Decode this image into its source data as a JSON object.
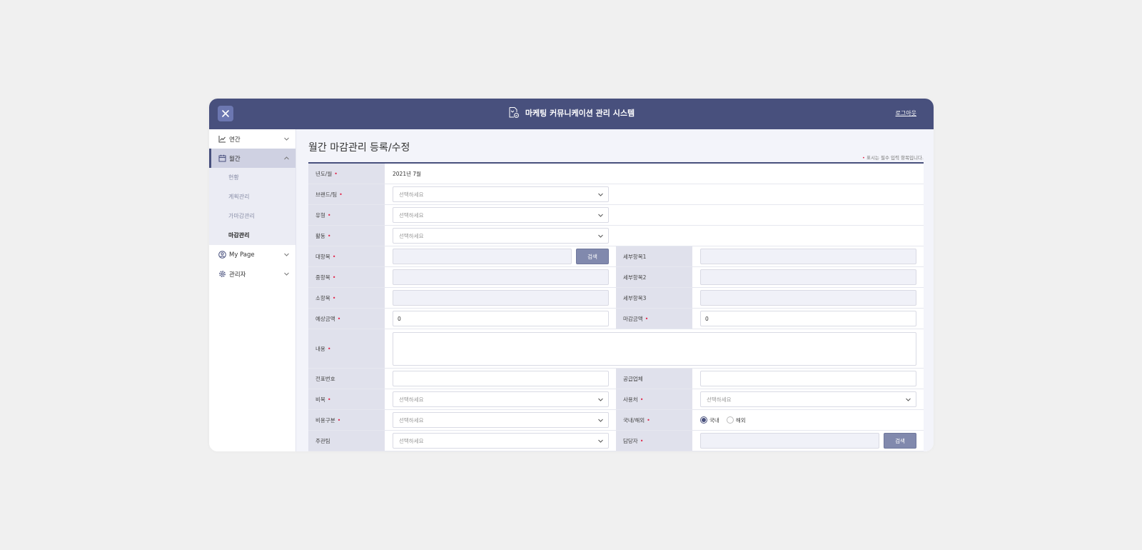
{
  "app": {
    "title": "마케팅 커뮤니케이션 관리 시스템",
    "logout_label": "로그아웃"
  },
  "sidebar": {
    "items": [
      {
        "label": "연간"
      },
      {
        "label": "월간"
      },
      {
        "label": "My Page"
      },
      {
        "label": "관리자"
      }
    ],
    "sub_items": [
      {
        "label": "현황"
      },
      {
        "label": "계획관리"
      },
      {
        "label": "가마감관리"
      },
      {
        "label": "마감관리"
      }
    ]
  },
  "page": {
    "title": "월간 마감관리 등록/수정",
    "required_note": "표시는 필수 입력 항목입니다.",
    "required_mark": "•"
  },
  "form": {
    "year_month": {
      "label": "년도/월",
      "value": "2021년 7월"
    },
    "brand_team": {
      "label": "브랜드/팀",
      "value": "선택하세요"
    },
    "type": {
      "label": "유형",
      "value": "선택하세요"
    },
    "activity": {
      "label": "활동",
      "value": "선택하세요"
    },
    "major_item": {
      "label": "대항목",
      "button": "검색"
    },
    "detail1": {
      "label": "세부항목1"
    },
    "middle_item": {
      "label": "중항목"
    },
    "detail2": {
      "label": "세부항목2"
    },
    "minor_item": {
      "label": "소항목"
    },
    "detail3": {
      "label": "세부항목3"
    },
    "expected_amount": {
      "label": "예상금액",
      "value": "0"
    },
    "closing_amount": {
      "label": "마감금액",
      "value": "0"
    },
    "content": {
      "label": "내용"
    },
    "slip_number": {
      "label": "전표번호"
    },
    "supplier": {
      "label": "공급업체"
    },
    "expense_item": {
      "label": "비목",
      "value": "선택하세요"
    },
    "usage_place": {
      "label": "사용처",
      "value": "선택하세요"
    },
    "expense_category": {
      "label": "비용구분",
      "value": "선택하세요"
    },
    "domestic_overseas": {
      "label": "국내/해외",
      "options": [
        "국내",
        "해외"
      ],
      "selected": "국내"
    },
    "lead_team": {
      "label": "주관팀",
      "value": "선택하세요"
    },
    "manager": {
      "label": "담당자",
      "button": "검색"
    }
  },
  "colors": {
    "header": "#48507d",
    "accent_button": "#8189ad",
    "required": "#e0284c",
    "label_bg": "#e0e1ec"
  }
}
